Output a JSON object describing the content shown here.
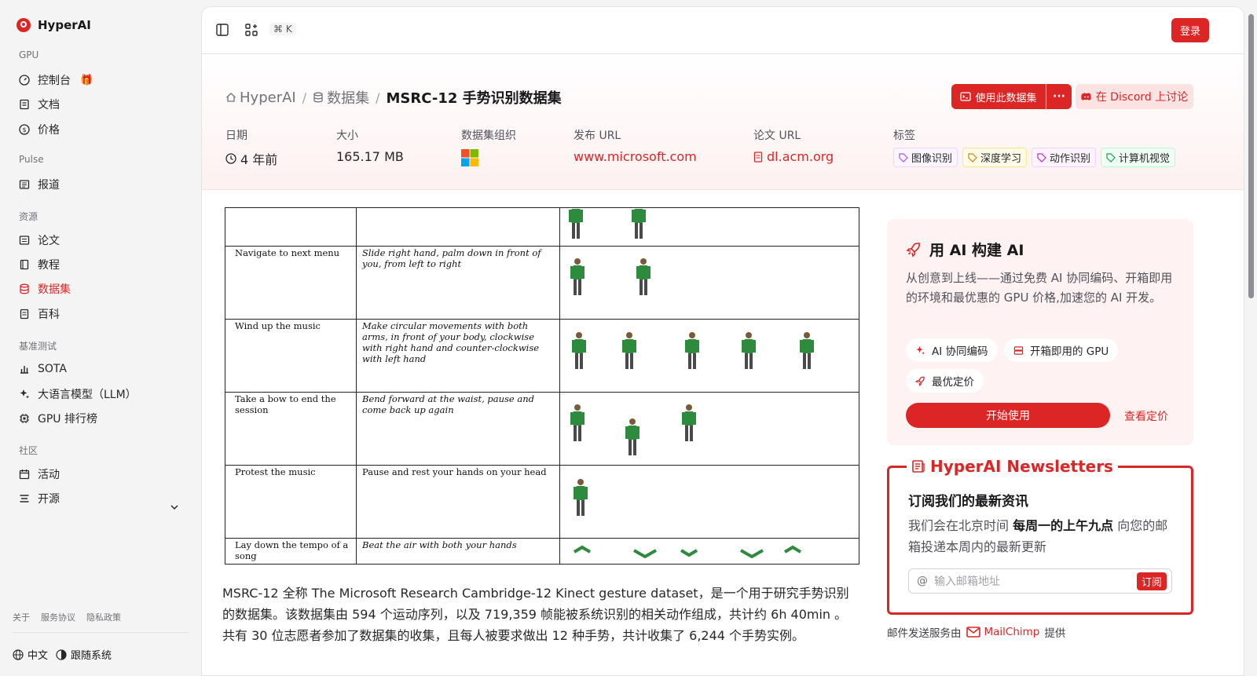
{
  "brand": {
    "name": "HyperAI"
  },
  "sidebar": {
    "sections": [
      {
        "label": "GPU"
      },
      {
        "label": "Pulse"
      },
      {
        "label": "资源"
      },
      {
        "label": "基准测试"
      },
      {
        "label": "社区"
      }
    ],
    "items": [
      {
        "label": "控制台",
        "icon": "gauge-icon"
      },
      {
        "label": "文档",
        "icon": "doc-icon"
      },
      {
        "label": "价格",
        "icon": "dollar-icon"
      },
      {
        "label": "报道",
        "icon": "newspaper-icon"
      },
      {
        "label": "论文",
        "icon": "paper-icon"
      },
      {
        "label": "教程",
        "icon": "book-icon"
      },
      {
        "label": "数据集",
        "icon": "database-icon",
        "active": true
      },
      {
        "label": "百科",
        "icon": "wiki-icon"
      },
      {
        "label": "SOTA",
        "icon": "bar-chart-icon"
      },
      {
        "label": "大语言模型（LLM）",
        "icon": "sparkle-icon"
      },
      {
        "label": "GPU 排行榜",
        "icon": "chip-icon"
      },
      {
        "label": "活动",
        "icon": "calendar-icon"
      },
      {
        "label": "开源",
        "icon": "list-icon"
      }
    ],
    "footer_links": [
      "关于",
      "服务协议",
      "隐私政策"
    ],
    "language": "中文",
    "theme": "跟随系统"
  },
  "topbar": {
    "shortcut": "⌘ K",
    "login": "登录"
  },
  "breadcrumb": {
    "home": "HyperAI",
    "datasets": "数据集",
    "current": "MSRC-12 手势识别数据集"
  },
  "actions": {
    "use_dataset": "使用此数据集",
    "more": "···",
    "discord": "在 Discord 上讨论"
  },
  "meta": {
    "date_label": "日期",
    "date_value": "4 年前",
    "size_label": "大小",
    "size_value": "165.17 MB",
    "org_label": "数据集组织",
    "url_label": "发布 URL",
    "url_value": "www.microsoft.com",
    "paper_label": "论文 URL",
    "paper_value": "dl.acm.org",
    "tags_label": "标签",
    "tags": [
      {
        "label": "图像识别",
        "color": "#a855f7"
      },
      {
        "label": "深度学习",
        "color": "#ca8a04"
      },
      {
        "label": "动作识别",
        "color": "#c026d3"
      },
      {
        "label": "计算机视觉",
        "color": "#16a34a"
      }
    ]
  },
  "figure": {
    "rows": [
      {
        "gesture": "",
        "instruction": ""
      },
      {
        "gesture": "Navigate to next menu",
        "instruction": "Slide right hand, palm down in front of you, from left to right"
      },
      {
        "gesture": "Wind up the music",
        "instruction": "Make circular movements with both arms, in front of your body, clockwise with right hand and counter-clockwise with left hand"
      },
      {
        "gesture": "Take a bow to end the session",
        "instruction": "Bend forward at the waist, pause and come back up again"
      },
      {
        "gesture": "Protest the music",
        "instruction": "Pause and rest your hands on your head"
      },
      {
        "gesture": "Lay down the tempo of a song",
        "instruction": "Beat the air with both your hands"
      }
    ]
  },
  "description": "MSRC-12 全称 The Microsoft Research Cambridge-12 Kinect gesture dataset，是一个用于研究手势识别的数据集。该数据集由 594 个运动序列，以及 719,359 帧能被系统识别的相关动作组成，共计约 6h 40min 。共有 30 位志愿者参加了数据集的收集，且每人被要求做出 12 种手势，共计收集了 6,244 个手势实例。",
  "ai_card": {
    "title": "用 AI 构建 AI",
    "desc": "从创意到上线——通过免费 AI 协同编码、开箱即用的环境和最优惠的 GPU 价格,加速您的 AI 开发。",
    "chips": [
      "AI 协同编码",
      "开箱即用的 GPU",
      "最优定价"
    ],
    "start": "开始使用",
    "pricing": "查看定价"
  },
  "newsletter": {
    "title": "HyperAI Newsletters",
    "subtitle": "订阅我们的最新资讯",
    "desc_pre": "我们会在北京时间 ",
    "desc_bold": "每周一的上午九点",
    "desc_post": " 向您的邮箱投递本周内的最新更新",
    "placeholder": "输入邮箱地址",
    "subscribe": "订阅",
    "note_pre": "邮件发送服务由",
    "note_brand": "MailChimp",
    "note_post": "提供"
  },
  "colors": {
    "accent": "#dc2626"
  }
}
